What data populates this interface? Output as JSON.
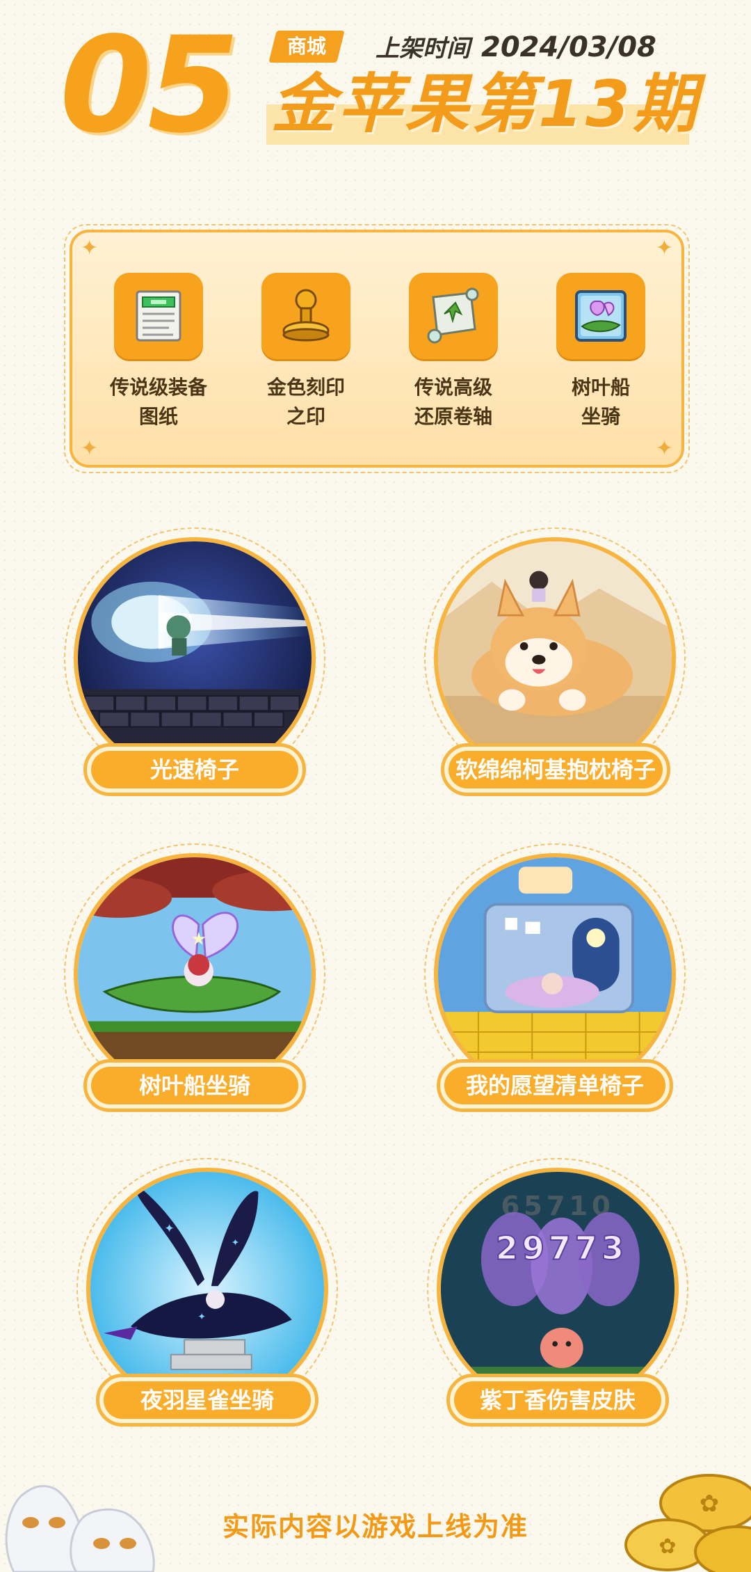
{
  "header": {
    "number": "05",
    "tag": "商城",
    "date_label": "上架时间",
    "date": "2024/03/08",
    "title": "金苹果第13期"
  },
  "featured": {
    "items": [
      {
        "label_line1": "传说级装备",
        "label_line2": "图纸",
        "icon": "blueprint-scroll-icon"
      },
      {
        "label_line1": "金色刻印",
        "label_line2": "之印",
        "icon": "golden-stamp-icon"
      },
      {
        "label_line1": "传说高级",
        "label_line2": "还原卷轴",
        "icon": "restore-scroll-icon"
      },
      {
        "label_line1": "树叶船",
        "label_line2": "坐骑",
        "icon": "leaf-boat-mount-icon"
      }
    ]
  },
  "showcase": {
    "items": [
      {
        "label": "光速椅子",
        "scene": "light-speed-chair-image"
      },
      {
        "label": "软绵绵柯基抱枕椅子",
        "scene": "corgi-pillow-chair-image"
      },
      {
        "label": "树叶船坐骑",
        "scene": "leaf-boat-mount-image"
      },
      {
        "label": "我的愿望清单椅子",
        "scene": "wishlist-chair-image"
      },
      {
        "label": "夜羽星雀坐骑",
        "scene": "night-feather-bird-mount-image"
      },
      {
        "label": "紫丁香伤害皮肤",
        "scene": "lilac-damage-skin-image"
      }
    ]
  },
  "damage_skin_sample": {
    "top": "65710",
    "bottom": "29773"
  },
  "footer": {
    "note": "实际内容以游戏上线为准"
  },
  "colors": {
    "accent": "#f7a31e",
    "title": "#f39b1a",
    "background": "#fbf8ee"
  }
}
